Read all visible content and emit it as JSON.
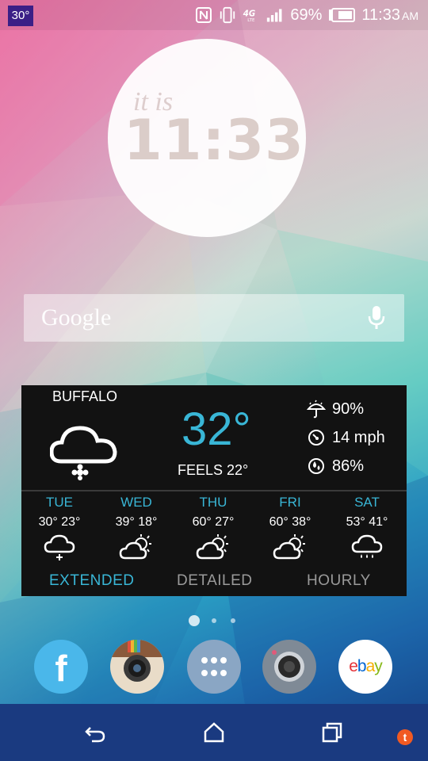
{
  "status_bar": {
    "temp_badge": "30°",
    "battery": "69%",
    "time": "11:33",
    "ampm": "AM",
    "icons": [
      "nfc-icon",
      "vibrate-icon",
      "4g-lte-icon",
      "signal-icon",
      "battery-icon"
    ]
  },
  "clock_widget": {
    "caption": "it is",
    "time": "11:33"
  },
  "search": {
    "label": "Google",
    "icon": "mic-icon"
  },
  "weather": {
    "city": "BUFFALO",
    "condition_icon": "snow-cloud-icon",
    "temp": "32°",
    "feels_like": "FEELS 22°",
    "precip": "90%",
    "wind": "14 mph",
    "humidity": "86%",
    "forecast": [
      {
        "day": "TUE",
        "range": "30° 23°",
        "icon": "snow-cloud-icon"
      },
      {
        "day": "WED",
        "range": "39° 18°",
        "icon": "partly-sunny-icon"
      },
      {
        "day": "THU",
        "range": "60° 27°",
        "icon": "partly-sunny-icon"
      },
      {
        "day": "FRI",
        "range": "60° 38°",
        "icon": "partly-sunny-icon"
      },
      {
        "day": "SAT",
        "range": "53° 41°",
        "icon": "rain-cloud-icon"
      }
    ],
    "tabs": [
      "EXTENDED",
      "DETAILED",
      "HOURLY"
    ],
    "accent_color": "#39b6d6"
  },
  "dock": {
    "apps": [
      "facebook",
      "instagram",
      "app-drawer",
      "camera",
      "ebay"
    ],
    "facebook_label": "f",
    "ebay_e": "e",
    "ebay_b": "b",
    "ebay_a": "a",
    "ebay_y": "y"
  },
  "nav": {
    "buttons": [
      "back",
      "home",
      "recents"
    ],
    "tapatalk_label": "t"
  }
}
